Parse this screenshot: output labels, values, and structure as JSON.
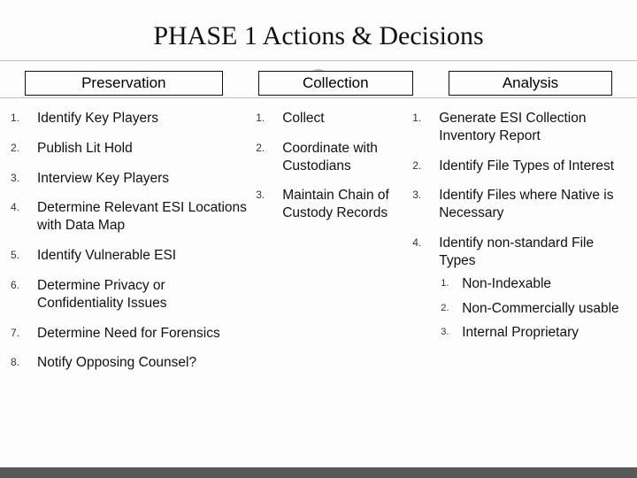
{
  "title": "PHASE 1 Actions & Decisions",
  "columns": {
    "preservation": {
      "header": "Preservation",
      "items": [
        "Identify Key Players",
        "Publish Lit Hold",
        "Interview Key Players",
        "Determine Relevant ESI Locations with Data Map",
        "Identify Vulnerable ESI",
        "Determine Privacy or Confidentiality Issues",
        "Determine Need for Forensics",
        "Notify Opposing Counsel?"
      ]
    },
    "collection": {
      "header": "Collection",
      "items": [
        "Collect",
        "Coordinate with Custodians",
        "Maintain Chain of Custody Records"
      ]
    },
    "analysis": {
      "header": "Analysis",
      "items": [
        {
          "text": "Generate ESI Collection Inventory Report"
        },
        {
          "text": "Identify File Types of Interest"
        },
        {
          "text": "Identify Files where Native is Necessary"
        },
        {
          "text": "Identify non-standard File Types",
          "sub": [
            "Non-Indexable",
            "Non-Commercially usable",
            "Internal Proprietary"
          ]
        }
      ]
    }
  }
}
